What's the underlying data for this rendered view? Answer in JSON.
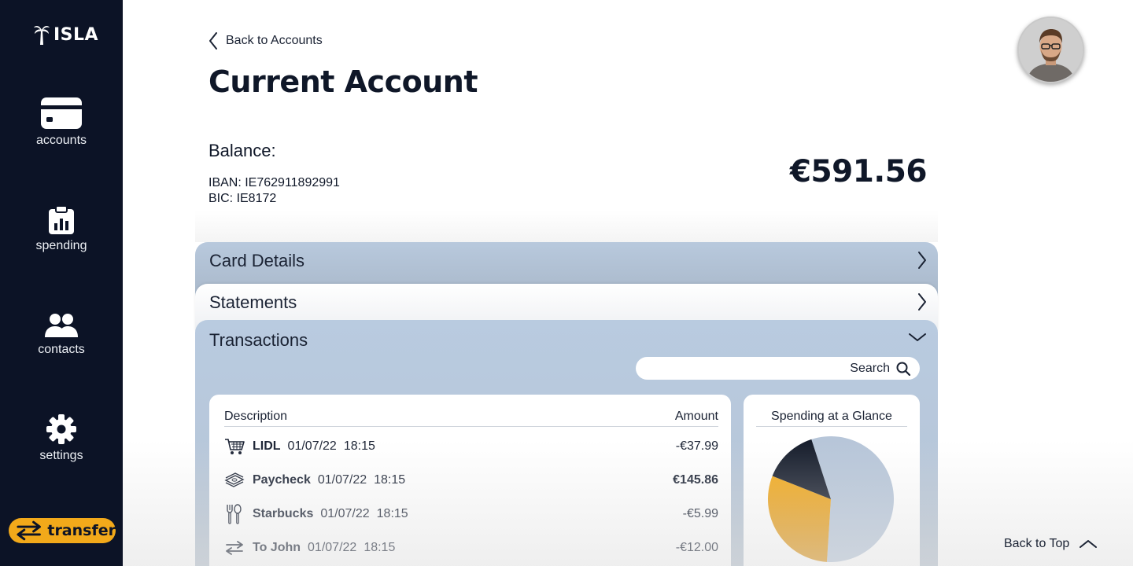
{
  "brand": {
    "name": "ISLA"
  },
  "sidebar": {
    "items": [
      {
        "label": "accounts",
        "icon": "credit-card-icon"
      },
      {
        "label": "spending",
        "icon": "clipboard-chart-icon"
      },
      {
        "label": "contacts",
        "icon": "users-icon"
      },
      {
        "label": "settings",
        "icon": "gear-icon"
      }
    ],
    "transfer_label": "transfer"
  },
  "header": {
    "back_label": "Back to Accounts",
    "title": "Current Account"
  },
  "account": {
    "balance_label": "Balance:",
    "iban": "IBAN: IE762911892991",
    "bic": "BIC: IE8172",
    "balance": "€591.56"
  },
  "panels": {
    "card_details": "Card Details",
    "statements": "Statements",
    "transactions": "Transactions"
  },
  "search": {
    "label": "Search",
    "value": ""
  },
  "transactions": {
    "columns": {
      "description": "Description",
      "amount": "Amount"
    },
    "rows": [
      {
        "name": "LIDL",
        "date": "01/07/22",
        "time": "18:15",
        "amount": "-€37.99",
        "icon": "shopping-cart-icon"
      },
      {
        "name": "Paycheck",
        "date": "01/07/22",
        "time": "18:15",
        "amount": "€145.86",
        "icon": "cash-stack-icon"
      },
      {
        "name": "Starbucks",
        "date": "01/07/22",
        "time": "18:15",
        "amount": "-€5.99",
        "icon": "cutlery-icon"
      },
      {
        "name": "To John",
        "date": "01/07/22",
        "time": "18:15",
        "amount": "-€12.00",
        "icon": "transfer-arrows-icon"
      }
    ]
  },
  "spending": {
    "title": "Spending at a Glance"
  },
  "chart_data": {
    "type": "pie",
    "title": "Spending at a Glance",
    "values": [
      56,
      30,
      14
    ],
    "colors": [
      "#b7c6d9",
      "#f2a91a",
      "#161d2c"
    ]
  },
  "footer": {
    "back_to_top": "Back to Top"
  },
  "colors": {
    "sidebar": "#0c1326",
    "accent": "#f2a91a",
    "panel": "#b9cbe0"
  }
}
